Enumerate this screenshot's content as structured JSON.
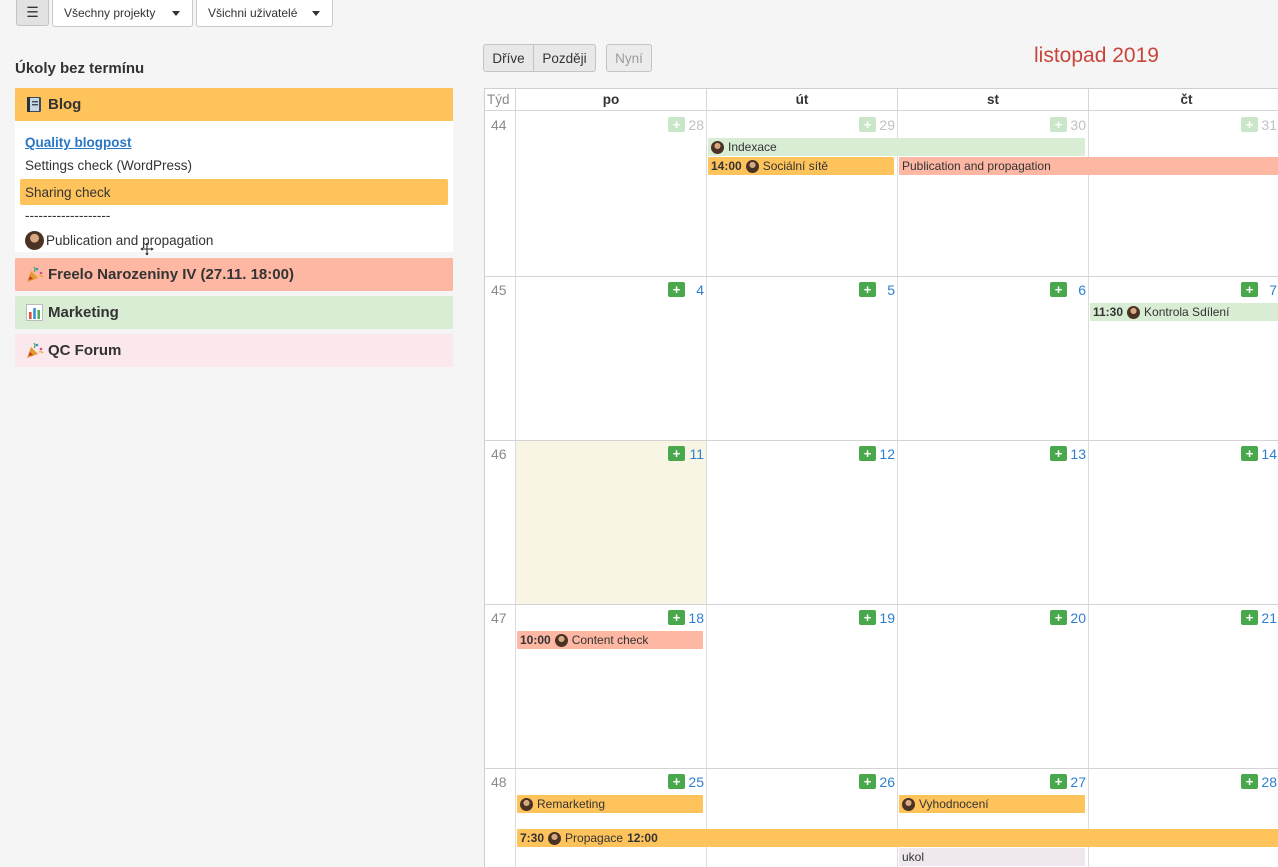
{
  "toolbar": {
    "menu_icon": "hamburger-icon",
    "projects_label": "Všechny projekty",
    "users_label": "Všichni uživatelé"
  },
  "sidebar": {
    "title": "Úkoly bez termínu",
    "groups": [
      {
        "label": "Blog",
        "icon": "notebook-icon",
        "color": "#ffc35c"
      },
      {
        "label": "Freelo Narozeniny IV (27.11. 18:00)",
        "icon": "party-popper-icon",
        "color": "#fdb7a3"
      },
      {
        "label": "Marketing",
        "icon": "bar-chart-icon",
        "color": "#d9ecd4"
      },
      {
        "label": "QC Forum",
        "icon": "party-popper-icon",
        "color": "#fbe8ec"
      }
    ],
    "blog_tasks": [
      {
        "label": "Quality blogpost"
      },
      {
        "label": "Settings check (WordPress)"
      },
      {
        "label": "Sharing check"
      },
      {
        "label": "-------------------"
      },
      {
        "label": "Publication and propagation"
      }
    ]
  },
  "calendar": {
    "nav": {
      "earlier": "Dříve",
      "later": "Později",
      "now": "Nyní"
    },
    "month_title": "listopad 2019",
    "headers": [
      "Týd",
      "po",
      "út",
      "st",
      "čt"
    ],
    "weeks": [
      {
        "week": "44",
        "days": [
          "28",
          "29",
          "30",
          "31"
        ]
      },
      {
        "week": "45",
        "days": [
          "4",
          "5",
          "6",
          "7"
        ]
      },
      {
        "week": "46",
        "days": [
          "11",
          "12",
          "13",
          "14"
        ]
      },
      {
        "week": "47",
        "days": [
          "18",
          "19",
          "20",
          "21"
        ]
      },
      {
        "week": "48",
        "days": [
          "25",
          "26",
          "27",
          "28"
        ]
      }
    ],
    "add_label": "+",
    "events": {
      "indexace": {
        "title": "Indexace"
      },
      "socialni": {
        "time": "14:00",
        "title": "Sociální sítě"
      },
      "publication": {
        "title": "Publication and propagation"
      },
      "kontrola": {
        "time": "11:30",
        "title": "Kontrola Sdílení"
      },
      "content": {
        "time": "10:00",
        "title": "Content check"
      },
      "remarketing": {
        "title": "Remarketing"
      },
      "vyhodnoceni": {
        "title": "Vyhodnocení"
      },
      "propagace": {
        "time": "7:30",
        "title": "Propagace",
        "end_time": "12:00"
      },
      "ukol": {
        "title": "ukol"
      }
    },
    "colors": {
      "orange": "#ffc35c",
      "salmon": "#fdb7a3",
      "green": "#d9ecd4",
      "accent_red": "#c9453c",
      "link_blue": "#2f7fd1"
    }
  }
}
